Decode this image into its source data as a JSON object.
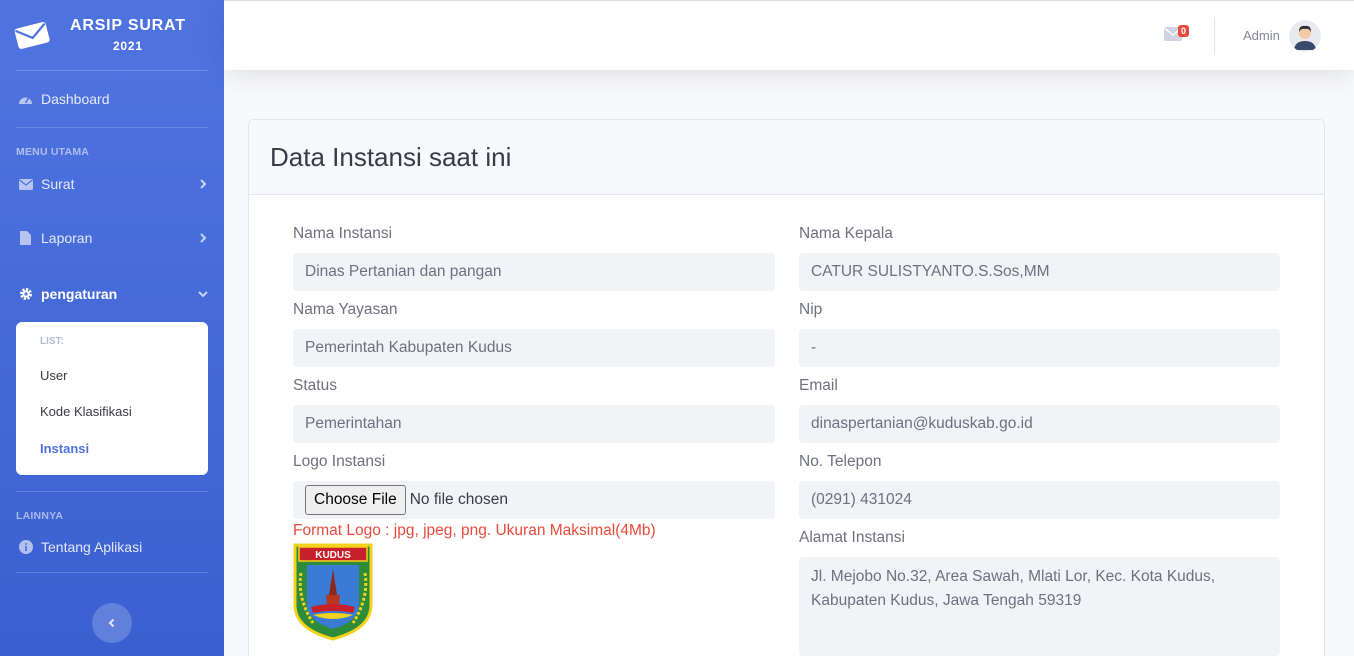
{
  "brand": {
    "title": "ARSIP SURAT",
    "year": "2021",
    "icon": "envelope-icon"
  },
  "sidebar": {
    "dashboard": "Dashboard",
    "menu_heading": "MENU UTAMA",
    "surat": "Surat",
    "laporan": "Laporan",
    "pengaturan": "pengaturan",
    "submenu": {
      "heading": "LIST:",
      "items": [
        "User",
        "Kode Klasifikasi",
        "Instansi"
      ]
    },
    "other_heading": "LAINNYA",
    "tentang": "Tentang Aplikasi"
  },
  "topbar": {
    "message_count": "0",
    "user_name": "Admin"
  },
  "card": {
    "title": "Data Instansi saat ini"
  },
  "form": {
    "nama_instansi": {
      "label": "Nama Instansi",
      "value": "Dinas Pertanian dan pangan"
    },
    "nama_yayasan": {
      "label": "Nama Yayasan",
      "value": "Pemerintah Kabupaten Kudus"
    },
    "status": {
      "label": "Status",
      "value": "Pemerintahan"
    },
    "logo": {
      "label": "Logo Instansi",
      "button": "Choose File",
      "file_status": "No file chosen",
      "note": "Format Logo : jpg, jpeg, png. Ukuran Maksimal(4Mb)",
      "logo_text": "KUDUS"
    },
    "nama_kepala": {
      "label": "Nama Kepala",
      "value": "CATUR SULISTYANTO.S.Sos,MM"
    },
    "nip": {
      "label": "Nip",
      "value": "-"
    },
    "email": {
      "label": "Email",
      "value": "dinaspertanian@kuduskab.go.id"
    },
    "telepon": {
      "label": "No. Telepon",
      "value": "(0291) 431024"
    },
    "alamat": {
      "label": "Alamat Instansi",
      "value": "Jl. Mejobo No.32, Area Sawah, Mlati Lor, Kec. Kota Kudus, Kabupaten Kudus, Jawa Tengah 59319"
    }
  },
  "colors": {
    "primary": "#4e73df",
    "danger": "#e74a3b",
    "field_bg": "#f2f3f7"
  }
}
